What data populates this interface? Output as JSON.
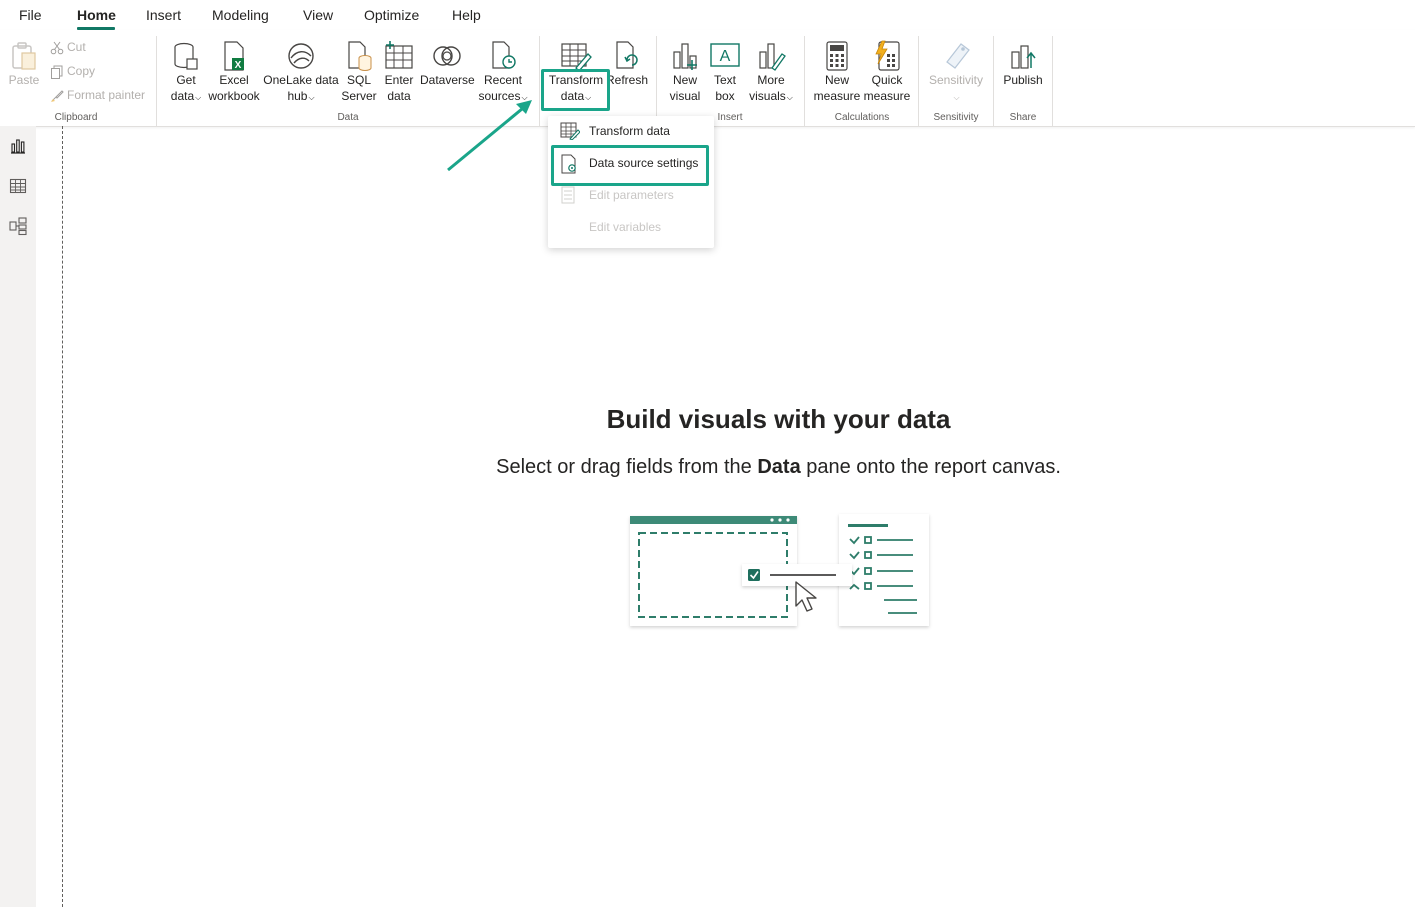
{
  "menu": {
    "tabs": [
      "File",
      "Home",
      "Insert",
      "Modeling",
      "View",
      "Optimize",
      "Help"
    ],
    "active": "Home"
  },
  "ribbon": {
    "clipboard": {
      "paste": "Paste",
      "cut": "Cut",
      "copy": "Copy",
      "format_painter": "Format painter",
      "group": "Clipboard"
    },
    "data": {
      "get_data": [
        "Get",
        "data"
      ],
      "excel": [
        "Excel",
        "workbook"
      ],
      "onelake": [
        "OneLake data",
        "hub"
      ],
      "sql": [
        "SQL",
        "Server"
      ],
      "enter": [
        "Enter",
        "data"
      ],
      "dataverse": "Dataverse",
      "recent": [
        "Recent",
        "sources"
      ],
      "group": "Data"
    },
    "queries": {
      "transform": [
        "Transform",
        "data"
      ],
      "refresh": "Refresh"
    },
    "insert": {
      "new_visual": [
        "New",
        "visual"
      ],
      "text_box": [
        "Text",
        "box"
      ],
      "more_visuals": [
        "More",
        "visuals"
      ],
      "group": "Insert"
    },
    "calculations": {
      "new_measure": [
        "New",
        "measure"
      ],
      "quick_measure": [
        "Quick",
        "measure"
      ],
      "group": "Calculations"
    },
    "sensitivity": {
      "label": "Sensitivity",
      "group": "Sensitivity"
    },
    "share": {
      "publish": "Publish",
      "group": "Share"
    }
  },
  "dropdown": {
    "items": [
      {
        "label": "Transform data",
        "enabled": true
      },
      {
        "label": "Data source settings",
        "enabled": true
      },
      {
        "label": "Edit parameters",
        "enabled": false
      },
      {
        "label": "Edit variables",
        "enabled": false
      }
    ]
  },
  "canvas": {
    "title": "Build visuals with your data",
    "subtitle_pre": "Select or drag fields from the ",
    "subtitle_bold": "Data",
    "subtitle_post": " pane onto the report canvas."
  },
  "colors": {
    "accent": "#117865",
    "highlight": "#1aa58a",
    "disabled": "#b3b0ad"
  }
}
